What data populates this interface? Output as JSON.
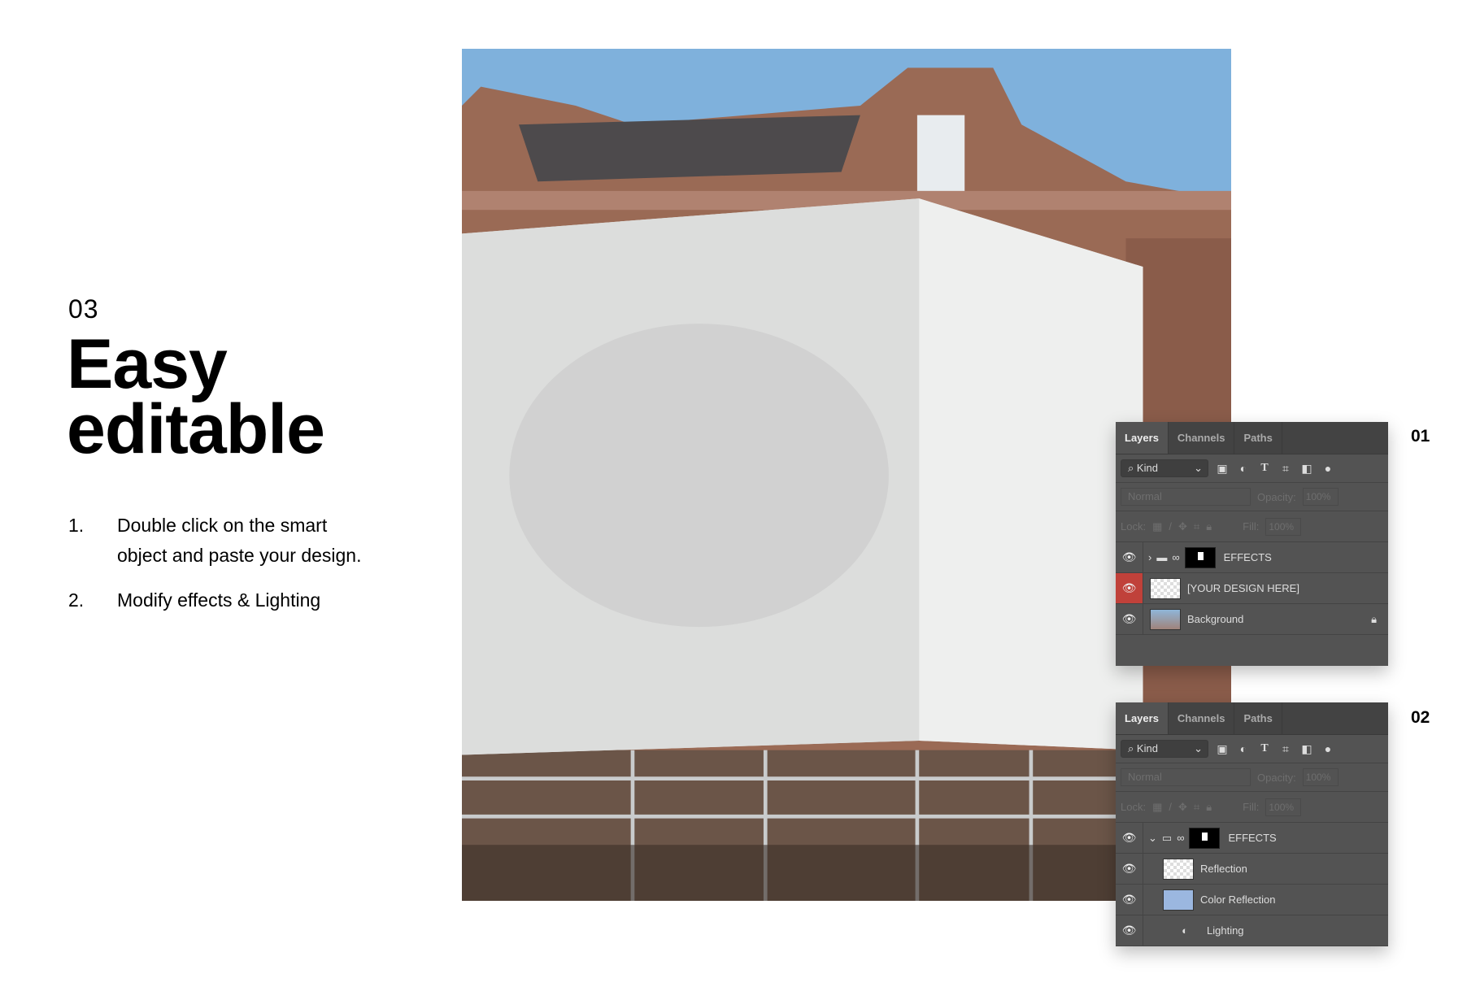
{
  "intro": {
    "number": "03",
    "title_line1": "Easy",
    "title_line2": "editable",
    "steps": [
      {
        "n": "1.",
        "line1": "Double click on the smart",
        "line2": "object and paste your design."
      },
      {
        "n": "2.",
        "line1": "Modify effects & Lighting",
        "line2": ""
      }
    ]
  },
  "panels": [
    {
      "badge": "01",
      "tabs": [
        "Layers",
        "Channels",
        "Paths"
      ],
      "filter": "Kind",
      "blend": "Normal",
      "opacity_label": "Opacity:",
      "opacity": "100%",
      "lock_label": "Lock:",
      "fill_label": "Fill:",
      "fill": "100%",
      "layers": [
        {
          "name": "EFFECTS",
          "type": "group-collapsed"
        },
        {
          "name": "[YOUR DESIGN HERE]",
          "type": "smart-object",
          "selected": true
        },
        {
          "name": "Background",
          "type": "image",
          "locked": true
        }
      ]
    },
    {
      "badge": "02",
      "tabs": [
        "Layers",
        "Channels",
        "Paths"
      ],
      "filter": "Kind",
      "blend": "Normal",
      "opacity_label": "Opacity:",
      "opacity": "100%",
      "lock_label": "Lock:",
      "fill_label": "Fill:",
      "fill": "100%",
      "layers": [
        {
          "name": "EFFECTS",
          "type": "group-expanded"
        },
        {
          "name": "Reflection",
          "type": "pixel"
        },
        {
          "name": "Color Reflection",
          "type": "fill",
          "color": "#9bb7e0"
        },
        {
          "name": "Lighting",
          "type": "adjustment"
        }
      ]
    }
  ],
  "colors": {
    "selected_layer": "#c0413a",
    "panel_bg": "#535353",
    "sky": "#7fb1dc"
  }
}
